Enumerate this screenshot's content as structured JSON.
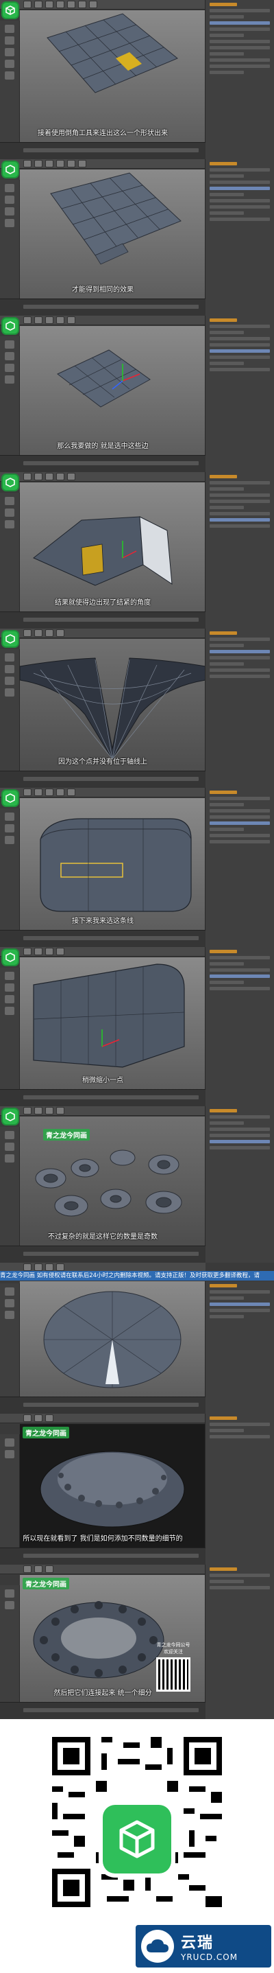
{
  "frames": [
    {
      "caption": "接着使用倒角工具来连出这么一个形状出来"
    },
    {
      "caption": "才能得到相同的效果"
    },
    {
      "caption": "那么我要做的 就是选中这些边"
    },
    {
      "caption": "结果就使得边出现了结紧的角度"
    },
    {
      "caption": "因为这个点并没有位于轴线上"
    },
    {
      "caption": "接下来我来选这条线"
    },
    {
      "caption": "稍微缩小一点"
    },
    {
      "caption": "不过复杂的就是这样它的数量是奇数",
      "watermark": "青之龙今同画"
    },
    {
      "caption": "",
      "banner": "青之龙今同画 如有侵权请在联系后24小时之内删除本视频。请支持正版！及时获取更多翻译教程，请"
    },
    {
      "caption": "所以现在就看到了 我们是如何添加不同数量的细节的",
      "watermark": "青之龙今同画"
    },
    {
      "caption": "然后把它们连接起来 统一个细分",
      "watermark": "青之龙今同画",
      "qr_label": "青之龙今同公号\n欢迎关注"
    }
  ],
  "footer": {
    "brand_name": "云瑞",
    "brand_url": "YRUCD.COM"
  },
  "colors": {
    "accent_green": "#29b64a",
    "banner_blue": "#2e6bb3",
    "brand_blue": "#0f4a86"
  }
}
